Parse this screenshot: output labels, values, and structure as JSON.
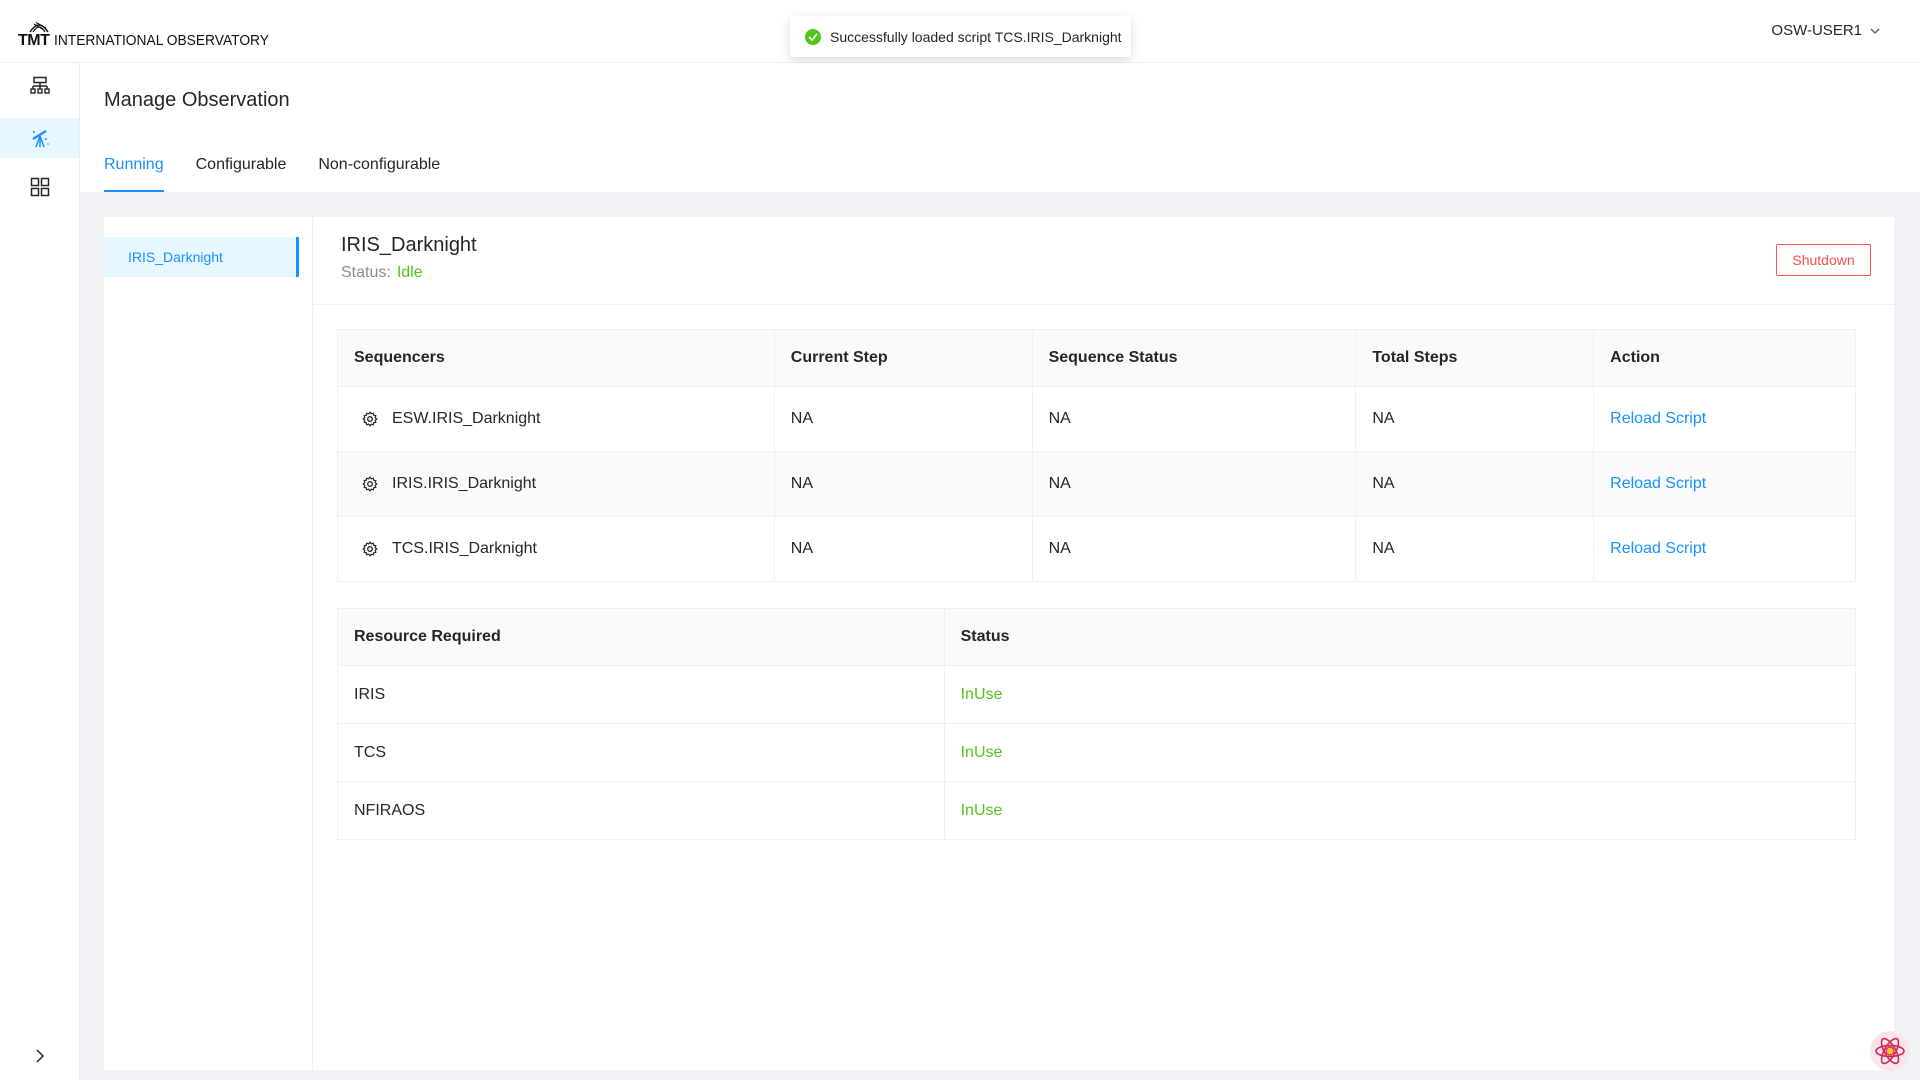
{
  "header": {
    "logo_mark": "TMT",
    "logo_text": "INTERNATIONAL OBSERVATORY",
    "user": "OSW-USER1"
  },
  "toast": {
    "message": "Successfully loaded script TCS.IRIS_Darknight"
  },
  "sidenav": {
    "items": [
      {
        "icon": "sitemap-icon"
      },
      {
        "icon": "telescope-icon",
        "active": true
      },
      {
        "icon": "grid-icon"
      }
    ],
    "collapse_icon": "chevron-right-icon"
  },
  "page": {
    "title": "Manage Observation",
    "tabs": [
      {
        "label": "Running",
        "active": true
      },
      {
        "label": "Configurable"
      },
      {
        "label": "Non-configurable"
      }
    ]
  },
  "observations": [
    {
      "name": "IRIS_Darknight",
      "selected": true
    }
  ],
  "detail": {
    "title": "IRIS_Darknight",
    "status_label": "Status:",
    "status_value": "Idle",
    "shutdown_label": "Shutdown"
  },
  "sequencers": {
    "headers": [
      "Sequencers",
      "Current Step",
      "Sequence Status",
      "Total Steps",
      "Action"
    ],
    "rows": [
      {
        "name": "ESW.IRIS_Darknight",
        "current_step": "NA",
        "sequence_status": "NA",
        "total_steps": "NA",
        "action": "Reload Script"
      },
      {
        "name": "IRIS.IRIS_Darknight",
        "current_step": "NA",
        "sequence_status": "NA",
        "total_steps": "NA",
        "action": "Reload Script"
      },
      {
        "name": "TCS.IRIS_Darknight",
        "current_step": "NA",
        "sequence_status": "NA",
        "total_steps": "NA",
        "action": "Reload Script"
      }
    ]
  },
  "resources": {
    "headers": [
      "Resource Required",
      "Status"
    ],
    "rows": [
      {
        "name": "IRIS",
        "status": "InUse"
      },
      {
        "name": "TCS",
        "status": "InUse"
      },
      {
        "name": "NFIRAOS",
        "status": "InUse"
      }
    ]
  },
  "colors": {
    "primary": "#1890ff",
    "success": "#52c41a",
    "danger": "#ff4d4f",
    "background": "#f0f2f5"
  }
}
